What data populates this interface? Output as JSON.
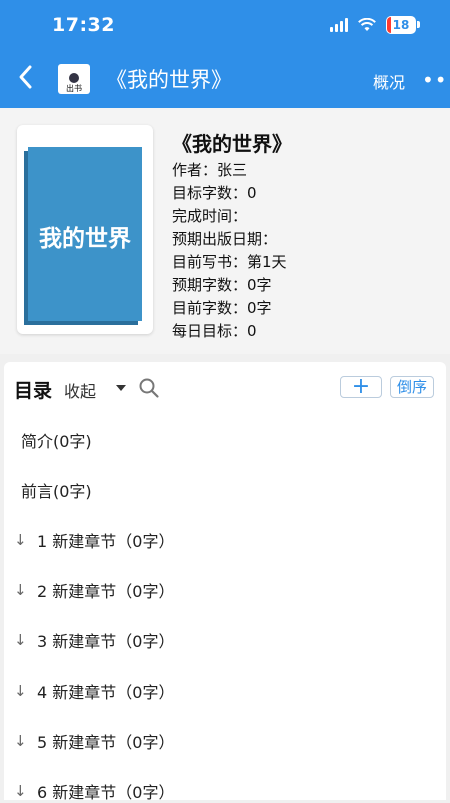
{
  "status_bar": {
    "time": "17:32",
    "battery": "18",
    "icons": [
      "signal-icon",
      "wifi-icon",
      "battery-icon"
    ]
  },
  "header": {
    "back_icon": "back-chevron-icon",
    "logo_text": "出书",
    "title": "《我的世界》",
    "overview_label": "概况",
    "more_label": "•••"
  },
  "book": {
    "cover_title": "我的世界",
    "title": "《我的世界》",
    "meta": [
      "作者：张三",
      "目标字数：0",
      "完成时间：",
      "预期出版日期：",
      "目前写书：第1天",
      "预期字数：0字",
      "目前字数：0字",
      "每日目标：0"
    ]
  },
  "toc": {
    "heading": "目录",
    "collapse_label": "收起",
    "add_label": "+",
    "order_label": "倒序",
    "items": [
      "简介(0字)",
      "前言(0字)"
    ],
    "chapters": [
      "1 新建章节（0字）",
      "2 新建章节（0字）",
      "3 新建章节（0字）",
      "4 新建章节（0字）",
      "5 新建章节（0字）",
      "6 新建章节（0字）"
    ]
  },
  "colors": {
    "header_blue": "#2f8fe8",
    "cover_blue": "#3d93c9",
    "battery_low": "#ff3b30"
  }
}
